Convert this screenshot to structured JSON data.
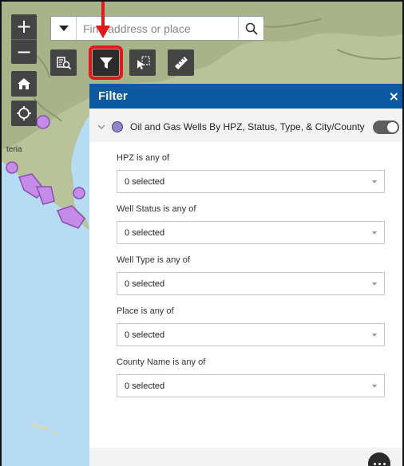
{
  "map": {
    "place_label": "teria"
  },
  "zoom": {
    "in_label": "+",
    "out_label": "−"
  },
  "search": {
    "placeholder": "Find address or place",
    "value": ""
  },
  "toolbar": {
    "active_tool": "filter"
  },
  "filter_panel": {
    "title": "Filter",
    "close_label": "×",
    "layer": {
      "title": "Oil and Gas Wells By HPZ, Status, Type, & City/County",
      "symbol_color": "#8f87c9",
      "toggle_on": false
    },
    "filters": [
      {
        "label": "HPZ is any of",
        "value": "0 selected"
      },
      {
        "label": "Well Status is any of",
        "value": "0 selected"
      },
      {
        "label": "Well Type is any of",
        "value": "0 selected"
      },
      {
        "label": "Place is any of",
        "value": "0 selected"
      },
      {
        "label": "County Name is any of",
        "value": "0 selected"
      }
    ]
  },
  "colors": {
    "header": "#0b5aa2",
    "annotation": "#e3181d",
    "water": "#b6dcf3",
    "well_fill": "#c48be8"
  }
}
